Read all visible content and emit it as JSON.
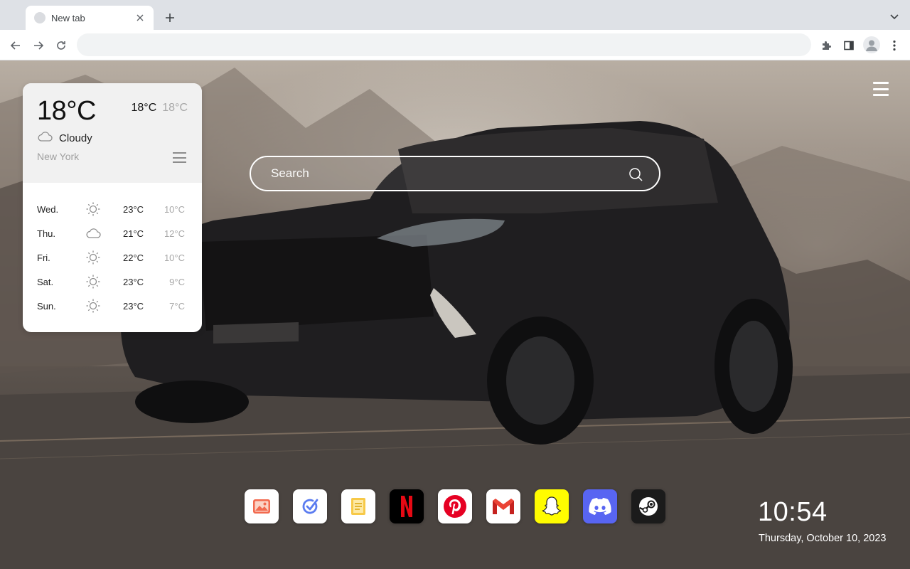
{
  "browser": {
    "tab_title": "New tab",
    "omnibox_value": "",
    "omnibox_placeholder": ""
  },
  "weather": {
    "current_temp": "18°C",
    "high": "18°C",
    "low": "18°C",
    "condition": "Cloudy",
    "condition_icon": "cloud-icon",
    "city": "New York",
    "forecast": [
      {
        "day": "Wed.",
        "icon": "sun-icon",
        "high": "23°C",
        "low": "10°C"
      },
      {
        "day": "Thu.",
        "icon": "cloud-icon",
        "high": "21°C",
        "low": "12°C"
      },
      {
        "day": "Fri.",
        "icon": "sun-icon",
        "high": "22°C",
        "low": "10°C"
      },
      {
        "day": "Sat.",
        "icon": "sun-icon",
        "high": "23°C",
        "low": "9°C"
      },
      {
        "day": "Sun.",
        "icon": "sun-icon",
        "high": "23°C",
        "low": "7°C"
      }
    ]
  },
  "search": {
    "placeholder": "Search"
  },
  "dock": {
    "apps": [
      {
        "name": "photos",
        "icon": "photos-icon",
        "color": "#ffffff"
      },
      {
        "name": "tasks",
        "icon": "check-icon",
        "color": "#ffffff"
      },
      {
        "name": "notes",
        "icon": "notes-icon",
        "color": "#ffffff"
      },
      {
        "name": "netflix",
        "icon": "netflix-icon",
        "color": "#000000"
      },
      {
        "name": "pinterest",
        "icon": "pinterest-icon",
        "color": "#ffffff"
      },
      {
        "name": "gmail",
        "icon": "gmail-icon",
        "color": "#ffffff"
      },
      {
        "name": "snapchat",
        "icon": "snapchat-icon",
        "color": "#fffc00"
      },
      {
        "name": "discord",
        "icon": "discord-icon",
        "color": "#5865f2"
      },
      {
        "name": "steam",
        "icon": "steam-icon",
        "color": "#1b1b1b"
      }
    ]
  },
  "clock": {
    "time": "10:54",
    "date": "Thursday, October 10, 2023"
  }
}
